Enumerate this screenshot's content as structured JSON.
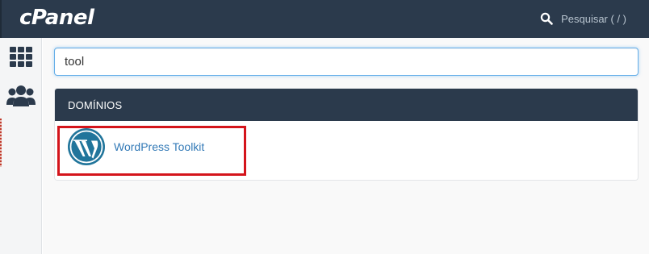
{
  "header": {
    "logo_text": "cPanel",
    "search_label": "Pesquisar ( / )",
    "search_icon": "search-icon"
  },
  "rail": {
    "items": [
      {
        "name": "apps-grid",
        "icon": "grid-icon"
      },
      {
        "name": "users",
        "icon": "users-icon"
      }
    ]
  },
  "search": {
    "value": "tool"
  },
  "results": {
    "section_title": "DOMÍNIOS",
    "items": [
      {
        "label": "WordPress Toolkit",
        "icon": "wordpress-icon",
        "highlighted": true
      }
    ]
  },
  "colors": {
    "header_bg": "#2b3a4c",
    "link": "#337ab7",
    "highlight": "#d4141b",
    "focus": "#66afe9"
  }
}
